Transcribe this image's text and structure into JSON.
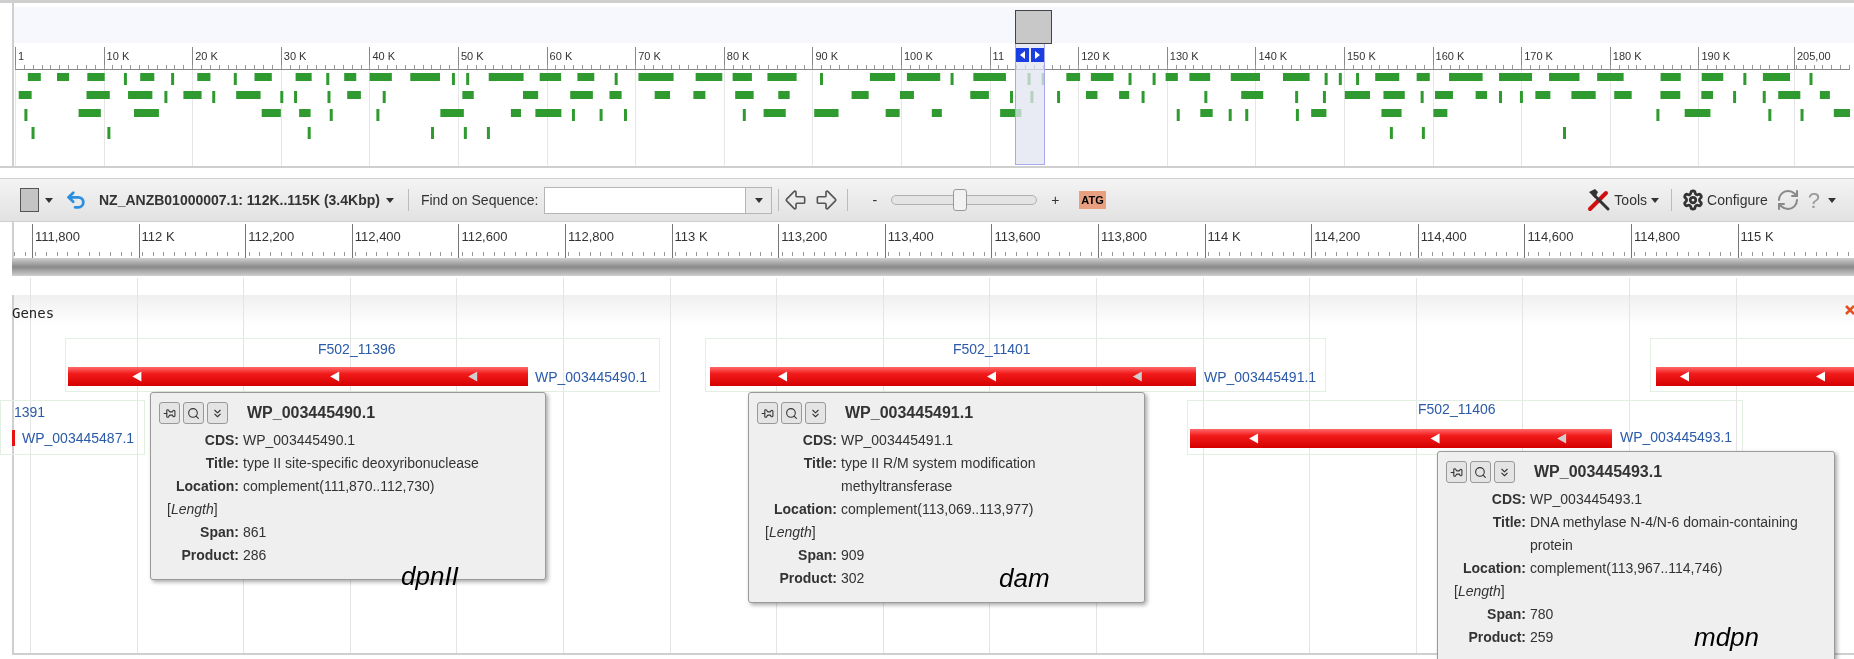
{
  "overview": {
    "ruler_labels": [
      "1",
      "10 K",
      "20 K",
      "30 K",
      "40 K",
      "50 K",
      "60 K",
      "70 K",
      "80 K",
      "90 K",
      "100 K",
      "11",
      "120 K",
      "130 K",
      "140 K",
      "150 K",
      "160 K",
      "170 K",
      "180 K",
      "190 K",
      "205,00"
    ]
  },
  "toolbar": {
    "location": "NZ_ANZB01000007.1: 112K..115K (3.4Kbp)",
    "find_label": "Find on Sequence:",
    "zoom_out": "-",
    "zoom": {
      "level": 0.47
    },
    "zoom_in": "+",
    "sequence_icon": "ATG",
    "tools": "Tools",
    "configure": "Configure",
    "help": "?"
  },
  "ruler_labels": [
    "111,800",
    "112 K",
    "112,200",
    "112,400",
    "112,600",
    "112,800",
    "113 K",
    "113,200",
    "113,400",
    "113,600",
    "113,800",
    "114 K",
    "114,200",
    "114,400",
    "114,600",
    "114,800",
    "115 K"
  ],
  "track": {
    "title": "Genes",
    "genes": [
      {
        "name": "1391",
        "accession": "WP_003445487.1"
      },
      {
        "name": "F502_11396",
        "accession": "WP_003445490.1"
      },
      {
        "name": "F502_11401",
        "accession": "WP_003445491.1"
      },
      {
        "name": "F502_11406",
        "accession": "WP_003445493.1"
      }
    ]
  },
  "tooltips": [
    {
      "title": "WP_003445490.1",
      "rows": [
        {
          "kind": "field",
          "label": "CDS:",
          "value": "WP_003445490.1"
        },
        {
          "kind": "field",
          "label": "Title:",
          "value": "type II site-specific deoxyribonuclease"
        },
        {
          "kind": "field",
          "label": "Location:",
          "value": "complement(111,870..112,730)"
        },
        {
          "kind": "note",
          "text": "[*Length*]"
        },
        {
          "kind": "field",
          "label": "Span:",
          "value": "861"
        },
        {
          "kind": "field",
          "label": "Product:",
          "value": "286"
        }
      ],
      "annotation": "dpnII"
    },
    {
      "title": "WP_003445491.1",
      "rows": [
        {
          "kind": "field",
          "label": "CDS:",
          "value": "WP_003445491.1"
        },
        {
          "kind": "field",
          "label": "Title:",
          "value": "type II R/M system modification methyltransferase"
        },
        {
          "kind": "field",
          "label": "Location:",
          "value": "complement(113,069..113,977)"
        },
        {
          "kind": "note",
          "text": "[*Length*]"
        },
        {
          "kind": "field",
          "label": "Span:",
          "value": "909"
        },
        {
          "kind": "field",
          "label": "Product:",
          "value": "302"
        }
      ],
      "annotation": "dam"
    },
    {
      "title": "WP_003445493.1",
      "rows": [
        {
          "kind": "field",
          "label": "CDS:",
          "value": "WP_003445493.1"
        },
        {
          "kind": "field",
          "label": "Title:",
          "value": "DNA methylase N-4/N-6 domain-containing protein"
        },
        {
          "kind": "field",
          "label": "Location:",
          "value": "complement(113,967..114,746)"
        },
        {
          "kind": "note",
          "text": "[*Length*]"
        },
        {
          "kind": "field",
          "label": "Span:",
          "value": "780"
        },
        {
          "kind": "field",
          "label": "Product:",
          "value": "259"
        }
      ],
      "annotation": "mdpn"
    }
  ]
}
